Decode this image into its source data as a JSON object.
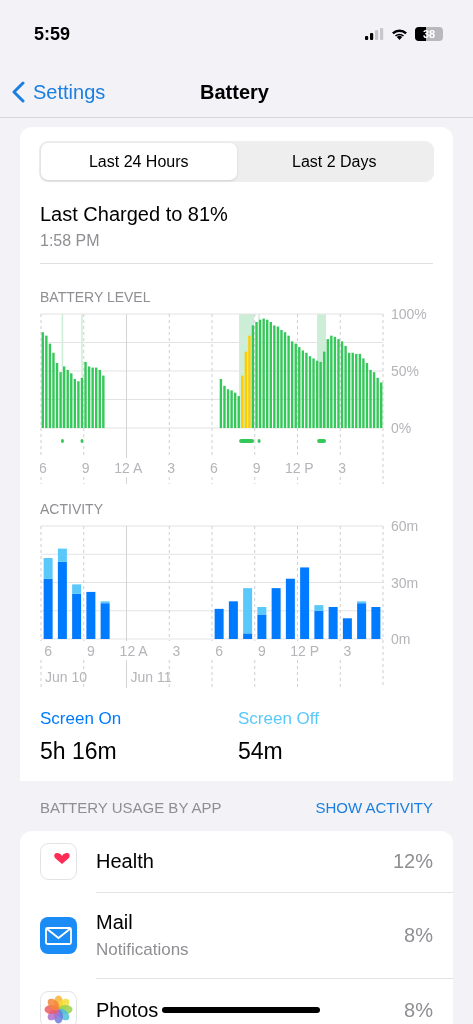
{
  "status_bar": {
    "time": "5:59",
    "battery": "38"
  },
  "nav": {
    "back": "Settings",
    "title": "Battery"
  },
  "segments": [
    {
      "label": "Last 24 Hours",
      "selected": true
    },
    {
      "label": "Last 2 Days",
      "selected": false
    }
  ],
  "last_charged": {
    "title": "Last Charged to 81%",
    "time": "1:58 PM"
  },
  "battery_level": {
    "title": "BATTERY LEVEL",
    "chart_data": {
      "type": "bar",
      "stacked": true,
      "ylim": [
        0,
        100
      ],
      "categories": [
        "6",
        null,
        null,
        null,
        null,
        null,
        null,
        null,
        null,
        null,
        null,
        null,
        "9",
        null,
        null,
        null,
        null,
        null,
        null,
        null,
        null,
        null,
        null,
        null,
        "12 A",
        null,
        null,
        null,
        null,
        null,
        null,
        null,
        null,
        null,
        null,
        null,
        "3",
        null,
        null,
        null,
        null,
        null,
        null,
        null,
        null,
        null,
        null,
        null,
        "6",
        null,
        null,
        null,
        null,
        null,
        null,
        null,
        null,
        null,
        null,
        null,
        "9",
        null,
        null,
        null,
        null,
        null,
        null,
        null,
        null,
        null,
        null,
        null,
        "12 P",
        null,
        null,
        null,
        null,
        null,
        null,
        null,
        null,
        null,
        null,
        null,
        "3",
        null,
        null,
        null,
        null,
        null,
        null,
        null,
        null,
        null,
        null,
        null
      ],
      "yticks": [
        {
          "value": 0,
          "label": "0%"
        },
        {
          "value": 50,
          "label": "50%"
        },
        {
          "value": 100,
          "label": "100%"
        }
      ],
      "series": [
        {
          "color": "#34c759",
          "values": [
            84,
            81,
            74,
            66,
            57,
            49,
            54,
            51,
            48,
            43,
            41,
            44,
            58,
            54,
            53,
            53,
            51,
            46,
            null,
            null,
            null,
            null,
            null,
            null,
            null,
            null,
            null,
            null,
            null,
            null,
            null,
            null,
            null,
            null,
            null,
            null,
            null,
            null,
            null,
            null,
            null,
            null,
            null,
            null,
            null,
            null,
            null,
            null,
            null,
            null,
            43,
            37,
            34,
            33,
            31,
            28,
            null,
            null,
            null,
            90,
            93,
            95,
            96,
            95,
            93,
            90,
            89,
            86,
            84,
            81,
            76,
            74,
            71,
            68,
            66,
            63,
            61,
            59,
            58,
            67,
            78,
            81,
            80,
            78,
            76,
            72,
            66,
            66,
            65,
            65,
            61,
            57,
            51,
            49,
            44,
            40
          ]
        },
        {
          "color": "#ffcc00",
          "values": [
            null,
            null,
            null,
            null,
            null,
            null,
            null,
            null,
            null,
            null,
            null,
            null,
            null,
            null,
            null,
            null,
            null,
            null,
            null,
            null,
            null,
            null,
            null,
            null,
            null,
            null,
            null,
            null,
            null,
            null,
            null,
            null,
            null,
            null,
            null,
            null,
            null,
            null,
            null,
            null,
            null,
            null,
            null,
            null,
            null,
            null,
            null,
            null,
            null,
            null,
            null,
            null,
            null,
            null,
            null,
            null,
            46,
            67,
            81,
            null,
            null,
            null,
            null,
            null,
            null,
            null,
            null,
            null,
            null,
            null,
            null,
            null,
            null,
            null,
            null,
            null,
            null,
            null,
            null,
            null,
            null,
            null,
            null,
            null,
            null,
            null,
            null,
            null,
            null,
            null,
            null,
            null,
            null,
            null,
            null,
            null
          ]
        }
      ]
    }
  },
  "activity": {
    "title": "ACTIVITY",
    "date_labels": [
      "Jun 10",
      "Jun 11"
    ],
    "chart_data": {
      "type": "bar",
      "stacked": true,
      "ylim": [
        0,
        60
      ],
      "categories": [
        "6",
        null,
        null,
        "9",
        null,
        null,
        "12 A",
        null,
        null,
        "3",
        null,
        null,
        "6",
        null,
        null,
        "9",
        null,
        null,
        "12 P",
        null,
        null,
        "3",
        null,
        null
      ],
      "yticks": [
        {
          "value": 0,
          "label": "0m"
        },
        {
          "value": 30,
          "label": "30m"
        },
        {
          "value": 60,
          "label": "60m"
        }
      ],
      "series": [
        {
          "color": "#007aff",
          "values": [
            32,
            41,
            24,
            25,
            19,
            null,
            null,
            null,
            null,
            null,
            null,
            null,
            16,
            20,
            3,
            13,
            27,
            32,
            38,
            15,
            17,
            11,
            19,
            17
          ]
        },
        {
          "color": "#5ac8fa",
          "values": [
            11,
            7,
            5,
            null,
            1,
            null,
            null,
            null,
            null,
            null,
            null,
            null,
            null,
            null,
            24,
            4,
            null,
            null,
            null,
            3,
            null,
            null,
            1,
            null
          ]
        }
      ]
    }
  },
  "totals": [
    {
      "label": "Screen On",
      "value": "5h 16m",
      "color": "#007aff"
    },
    {
      "label": "Screen Off",
      "value": "54m",
      "color": "#5ac8fa"
    }
  ],
  "usage": {
    "title": "BATTERY USAGE BY APP",
    "action": "SHOW ACTIVITY",
    "apps": [
      {
        "kind": "health",
        "name": "Health",
        "percent": "12%"
      },
      {
        "kind": "mail",
        "name": "Mail",
        "detail": "Notifications",
        "percent": "8%"
      },
      {
        "kind": "photos",
        "name": "Photos",
        "percent": "8%"
      }
    ]
  }
}
